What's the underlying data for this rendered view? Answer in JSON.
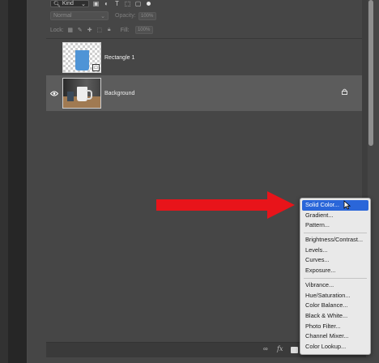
{
  "filter_bar": {
    "kind_label": "Kind",
    "icons": [
      "image-filter-icon",
      "adjustment-filter-icon",
      "type-filter-icon",
      "shape-filter-icon",
      "smart-object-filter-icon"
    ]
  },
  "blend": {
    "mode": "Normal",
    "opacity_label": "Opacity:",
    "opacity_value": "100%"
  },
  "lock_row": {
    "label": "Lock:",
    "fill_label": "Fill:",
    "fill_value": "100%"
  },
  "layers": [
    {
      "name": "Rectangle 1",
      "visible": false
    },
    {
      "name": "Background",
      "visible": true,
      "locked": true
    }
  ],
  "menu": {
    "items": [
      {
        "label": "Solid Color...",
        "highlighted": true
      },
      {
        "label": "Gradient..."
      },
      {
        "label": "Pattern..."
      },
      {
        "separator": true
      },
      {
        "label": "Brightness/Contrast..."
      },
      {
        "label": "Levels..."
      },
      {
        "label": "Curves..."
      },
      {
        "label": "Exposure..."
      },
      {
        "separator": true
      },
      {
        "label": "Vibrance..."
      },
      {
        "label": "Hue/Saturation..."
      },
      {
        "label": "Color Balance..."
      },
      {
        "label": "Black & White..."
      },
      {
        "label": "Photo Filter..."
      },
      {
        "label": "Channel Mixer..."
      },
      {
        "label": "Color Lookup..."
      }
    ]
  },
  "bottom_bar": {
    "fx_label": "fx"
  },
  "colors": {
    "arrow": "#e8141a",
    "highlight": "#2a66d9",
    "rectangle_fill": "#4f94d6"
  }
}
